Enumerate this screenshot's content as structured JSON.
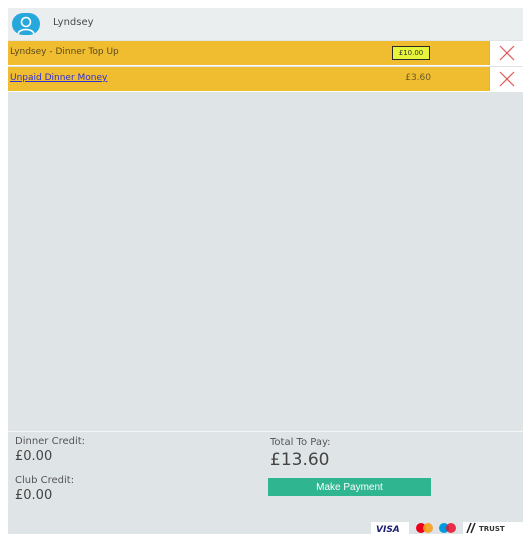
{
  "header": {
    "user_name": "Lyndsey"
  },
  "basket": {
    "items": [
      {
        "label": "Lyndsey - Dinner Top Up",
        "amount": "£10.00"
      },
      {
        "label": "Unpaid Dinner Money",
        "amount": "£3.60"
      }
    ]
  },
  "summary": {
    "dinner_credit_label": "Dinner Credit:",
    "dinner_credit_value": "£0.00",
    "club_credit_label": "Club Credit:",
    "club_credit_value": "£0.00",
    "total_label": "Total To Pay:",
    "total_value": "£13.60",
    "pay_button_label": "Make Payment"
  },
  "payment_logos": {
    "visa_text": "VISA",
    "trust_text": "TRUST"
  },
  "icons": {
    "avatar": "user-avatar-icon",
    "remove": "close-icon"
  },
  "colors": {
    "row_highlight": "#f0bd31",
    "amount_field": "#e6f53a",
    "pay_button": "#2fb590",
    "avatar": "#27a8dd",
    "remove_icon": "#e05a5a"
  }
}
